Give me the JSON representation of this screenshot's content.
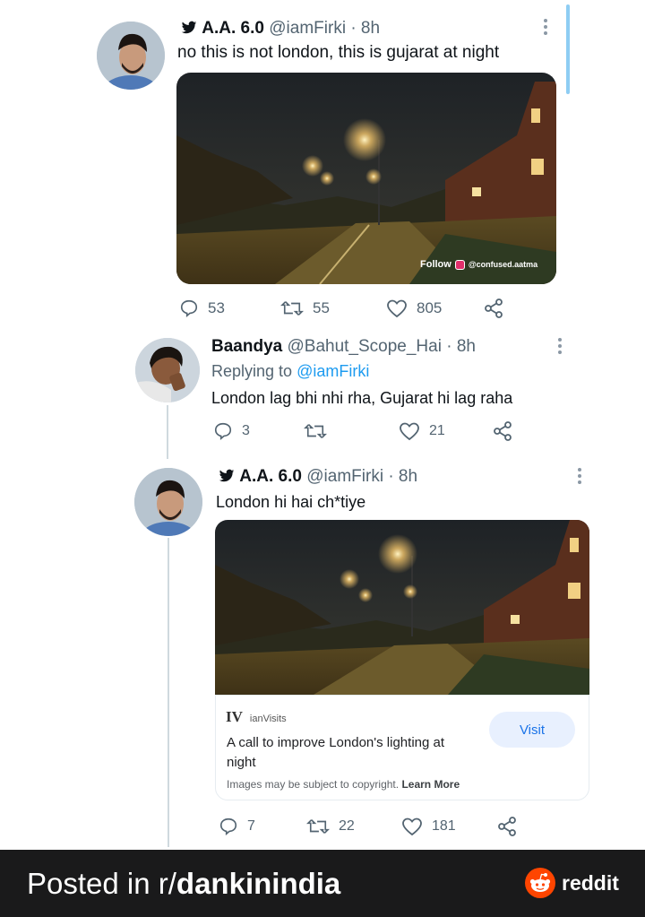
{
  "tweets": [
    {
      "name": "A.A. 6.0",
      "handle": "@iamFirki",
      "time": "· 8h",
      "text": "no this is not london, this is gujarat at night",
      "photo_overlay": {
        "follow": "Follow",
        "ig_handle": "@confused.aatma"
      },
      "stats": {
        "replies": "53",
        "retweets": "55",
        "likes": "805"
      }
    },
    {
      "name": "Baandya",
      "handle": "@Bahut_Scope_Hai",
      "time": "· 8h",
      "replying_prefix": "Replying to",
      "replying_to": "@iamFirki",
      "text": "London lag bhi nhi rha, Gujarat hi lag raha",
      "stats": {
        "replies": "3",
        "retweets": "",
        "likes": "21"
      }
    },
    {
      "name": "A.A. 6.0",
      "handle": "@iamFirki",
      "time": "· 8h",
      "text": "London hi hai ch*tiye",
      "card": {
        "logo": "IV",
        "source": "ianVisits",
        "title_line1": "A call to improve London's lighting at",
        "title_line2": "night",
        "button": "Visit",
        "copyright": "Images may be subject to copyright.",
        "learn_more": "Learn More"
      },
      "stats": {
        "replies": "7",
        "retweets": "22",
        "likes": "181"
      }
    }
  ],
  "footer": {
    "posted_prefix": "Posted in r/",
    "subreddit": "dankinindia",
    "brand": "reddit"
  },
  "colors": {
    "accent": "#1d9bf0",
    "muted": "#536471",
    "reddit_orange": "#ff4500",
    "footer_bg": "#1a1a1b"
  }
}
